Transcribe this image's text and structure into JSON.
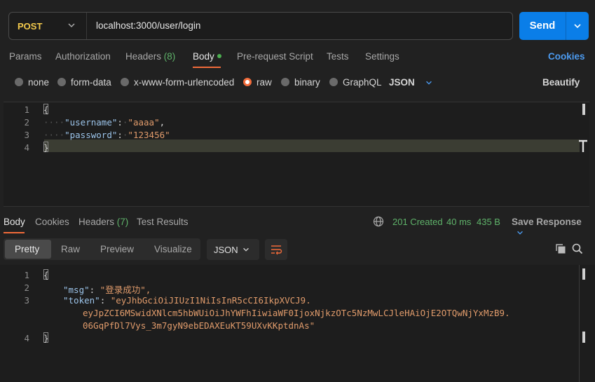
{
  "request": {
    "method": "POST",
    "url": "localhost:3000/user/login",
    "send_label": "Send",
    "tabs": [
      {
        "label": "Params"
      },
      {
        "label": "Authorization"
      },
      {
        "label": "Headers",
        "count": "(8)"
      },
      {
        "label": "Body"
      },
      {
        "label": "Pre-request Script"
      },
      {
        "label": "Tests"
      },
      {
        "label": "Settings"
      }
    ],
    "cookies_label": "Cookies",
    "body_types": [
      "none",
      "form-data",
      "x-www-form-urlencoded",
      "raw",
      "binary",
      "GraphQL"
    ],
    "body_format": "JSON",
    "beautify_label": "Beautify",
    "code_lines": [
      {
        "num": "1",
        "text": "{"
      },
      {
        "num": "2",
        "key": "\"username\"",
        "value": "\"aaaa\""
      },
      {
        "num": "3",
        "key": "\"password\"",
        "value": "\"123456\""
      },
      {
        "num": "4",
        "text": "}"
      }
    ]
  },
  "response": {
    "tabs": [
      {
        "label": "Body"
      },
      {
        "label": "Cookies"
      },
      {
        "label": "Headers",
        "count": "(7)"
      },
      {
        "label": "Test Results"
      }
    ],
    "status": "201 Created",
    "time": "40 ms",
    "size": "435 B",
    "save_label": "Save Response",
    "views": [
      "Pretty",
      "Raw",
      "Preview",
      "Visualize"
    ],
    "format": "JSON",
    "lines": [
      {
        "num": "1",
        "text": "{"
      },
      {
        "num": "2",
        "key": "\"msg\"",
        "value": "\"登录成功\","
      },
      {
        "num": "3",
        "key": "\"token\"",
        "value": "\"eyJhbGciOiJIUzI1NiIsInR5cCI6IkpXVCJ9.",
        "cont1": "eyJpZCI6MSwidXNlcm5hbWUiOiJhYWFhIiwiaWF0IjoxNjkzOTc5NzMwLCJleHAiOjE2OTQwNjYxMzB9.",
        "cont2": "06GqPfDl7Vys_3m7gyN9ebEDAXEuKT59UXvKKptdnAs\""
      },
      {
        "num": "4",
        "text": "}"
      }
    ]
  },
  "colors": {
    "accent": "#f26b3a",
    "send": "#0a7ee8",
    "status_ok": "#5fb36a",
    "link": "#4c9bf0"
  }
}
